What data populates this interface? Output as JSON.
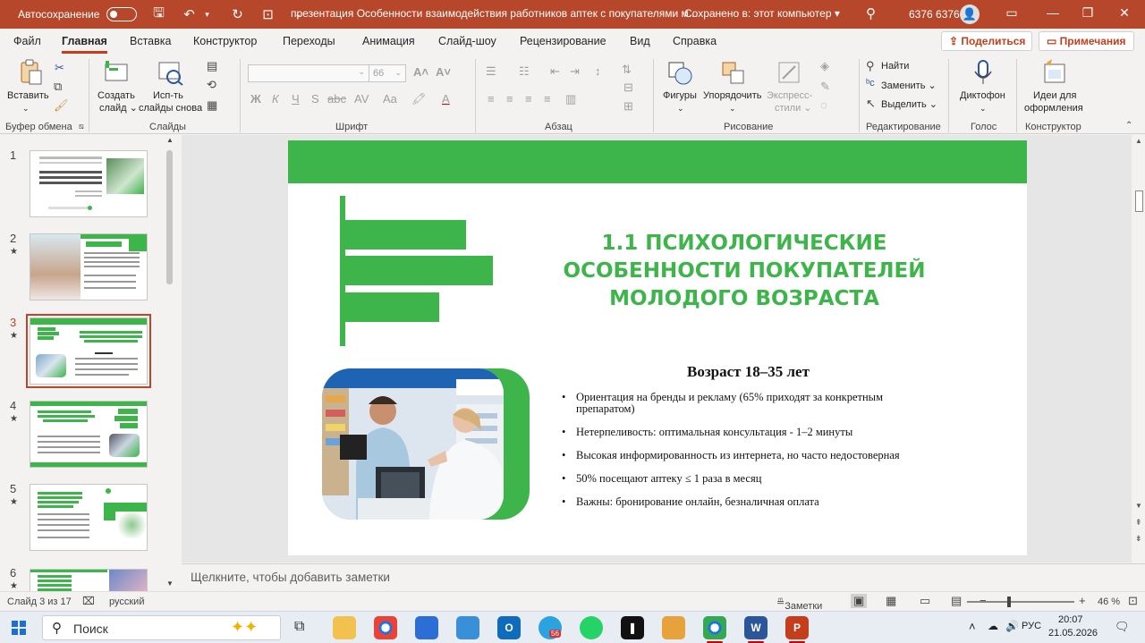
{
  "titlebar": {
    "autosave": "Автосохранение",
    "document_title": "презентация Особенности взаимодействия работников аптек с покупателями м...",
    "saved_state": "Сохранено в: этот компьютер",
    "user": "6376 6376"
  },
  "menu": {
    "tabs": [
      "Файл",
      "Главная",
      "Вставка",
      "Конструктор",
      "Переходы",
      "Анимация",
      "Слайд-шоу",
      "Рецензирование",
      "Вид",
      "Справка"
    ],
    "active_tab": "Главная",
    "share": "Поделиться",
    "comments": "Примечания"
  },
  "ribbon": {
    "groups": {
      "clipboard": "Буфер обмена",
      "slides": "Слайды",
      "font": "Шрифт",
      "paragraph": "Абзац",
      "drawing": "Рисование",
      "editing": "Редактирование",
      "voice": "Голос",
      "designer": "Конструктор"
    },
    "buttons": {
      "paste": "Вставить",
      "new_slide_1": "Создать",
      "new_slide_2": "слайд",
      "reuse_1": "Исп-ть",
      "reuse_2": "слайды снова",
      "shapes": "Фигуры",
      "arrange": "Упорядочить",
      "quick_styles_1": "Экспресс-",
      "quick_styles_2": "стили",
      "find": "Найти",
      "replace": "Заменить",
      "select": "Выделить",
      "dictate": "Диктофон",
      "design_ideas_1": "Идеи для",
      "design_ideas_2": "оформления"
    },
    "font_size": "66"
  },
  "thumbnails": [
    {
      "number": "1",
      "star": ""
    },
    {
      "number": "2",
      "star": "★"
    },
    {
      "number": "3",
      "star": "★"
    },
    {
      "number": "4",
      "star": "★"
    },
    {
      "number": "5",
      "star": "★"
    },
    {
      "number": "6",
      "star": "★"
    }
  ],
  "slide": {
    "title_line1": "1.1 ПСИХОЛОГИЧЕСКИЕ",
    "title_line2": "ОСОБЕННОСТИ ПОКУПАТЕЛЕЙ",
    "title_line3": "МОЛОДОГО ВОЗРАСТА",
    "subheading": "Возраст 18–35 лет",
    "bullets": [
      "Ориентация на бренды и рекламу (65% приходят за конкретным препаратом)",
      "Нетерпеливость: оптимальная консультация - 1–2 минуты",
      "Высокая информированность из интернета, но часто недостоверная",
      "50% посещают аптеку ≤ 1 раза в месяц",
      "Важны: бронирование онлайн, безналичная оплата"
    ]
  },
  "notes_placeholder": "Щелкните, чтобы добавить заметки",
  "statusbar": {
    "slide_info": "Слайд 3 из 17",
    "language": "русский",
    "notes": "Заметки",
    "zoom": "46 %"
  },
  "taskbar": {
    "search": "Поиск",
    "language": "РУС",
    "time": "20:07",
    "date": "21.05.2026",
    "badge": "56"
  },
  "colors": {
    "accent_ppt": "#b7472a",
    "slide_green": "#3db54a"
  }
}
